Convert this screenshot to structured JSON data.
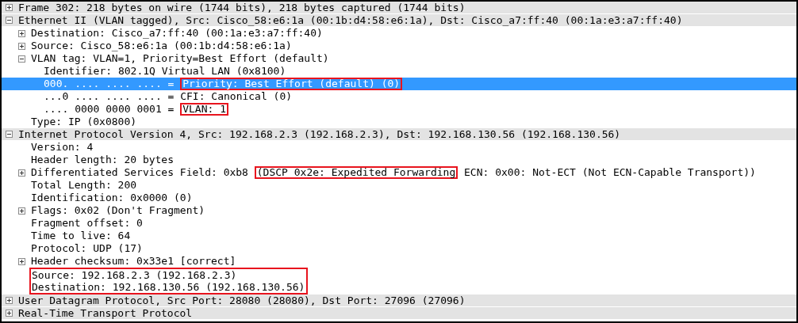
{
  "tree": [
    {
      "kind": "field",
      "expanded": false,
      "selected": false,
      "segments": [
        {
          "text": "Frame 302: 218 bytes on wire (1744 bits), 218 bytes captured (1744 bits)",
          "boxed": false
        }
      ]
    },
    {
      "kind": "field",
      "expanded": true,
      "selected": false,
      "segments": [
        {
          "text": "Ethernet II (VLAN tagged), Src: Cisco_58:e6:1a (00:1b:d4:58:e6:1a), Dst: Cisco_a7:ff:40 (00:1a:e3:a7:ff:40)",
          "boxed": false
        }
      ],
      "children": [
        {
          "kind": "field",
          "expanded": false,
          "selected": false,
          "segments": [
            {
              "text": "Destination: Cisco_a7:ff:40 (00:1a:e3:a7:ff:40)",
              "boxed": false
            }
          ]
        },
        {
          "kind": "field",
          "expanded": false,
          "selected": false,
          "segments": [
            {
              "text": "Source: Cisco_58:e6:1a (00:1b:d4:58:e6:1a)",
              "boxed": false
            }
          ]
        },
        {
          "kind": "field",
          "expanded": true,
          "selected": false,
          "segments": [
            {
              "text": "VLAN tag: VLAN=1, Priority=Best Effort (default)",
              "boxed": false
            }
          ],
          "children": [
            {
              "kind": "field",
              "selected": false,
              "segments": [
                {
                  "text": "Identifier: 802.1Q Virtual LAN (0x8100)",
                  "boxed": false
                }
              ]
            },
            {
              "kind": "field",
              "selected": true,
              "segments": [
                {
                  "text": "000. .... .... .... = ",
                  "boxed": false
                },
                {
                  "text": "Priority: Best Effort (default) (0)",
                  "boxed": true
                }
              ]
            },
            {
              "kind": "field",
              "selected": false,
              "segments": [
                {
                  "text": "...0 .... .... .... = CFI: Canonical (0)",
                  "boxed": false
                }
              ]
            },
            {
              "kind": "field",
              "selected": false,
              "segments": [
                {
                  "text": ".... 0000 0000 0001 = ",
                  "boxed": false
                },
                {
                  "text": "VLAN: 1",
                  "boxed": true
                }
              ]
            }
          ]
        },
        {
          "kind": "field",
          "selected": false,
          "segments": [
            {
              "text": "Type: IP (0x0800)",
              "boxed": false
            }
          ]
        }
      ]
    },
    {
      "kind": "field",
      "expanded": true,
      "selected": false,
      "segments": [
        {
          "text": "Internet Protocol Version 4, Src: 192.168.2.3 (192.168.2.3), Dst: 192.168.130.56 (192.168.130.56)",
          "boxed": false
        }
      ],
      "children": [
        {
          "kind": "field",
          "selected": false,
          "segments": [
            {
              "text": "Version: 4",
              "boxed": false
            }
          ]
        },
        {
          "kind": "field",
          "selected": false,
          "segments": [
            {
              "text": "Header length: 20 bytes",
              "boxed": false
            }
          ]
        },
        {
          "kind": "field",
          "expanded": false,
          "selected": false,
          "segments": [
            {
              "text": "Differentiated Services Field: 0xb8 ",
              "boxed": false
            },
            {
              "text": "(DSCP 0x2e: Expedited Forwarding",
              "boxed": true
            },
            {
              "text": " ECN: 0x00: Not-ECT (Not ECN-Capable Transport))",
              "boxed": false
            }
          ]
        },
        {
          "kind": "field",
          "selected": false,
          "segments": [
            {
              "text": "Total Length: 200",
              "boxed": false
            }
          ]
        },
        {
          "kind": "field",
          "selected": false,
          "segments": [
            {
              "text": "Identification: 0x0000 (0)",
              "boxed": false
            }
          ]
        },
        {
          "kind": "field",
          "expanded": false,
          "selected": false,
          "segments": [
            {
              "text": "Flags: 0x02 (Don't Fragment)",
              "boxed": false
            }
          ]
        },
        {
          "kind": "field",
          "selected": false,
          "segments": [
            {
              "text": "Fragment offset: 0",
              "boxed": false
            }
          ]
        },
        {
          "kind": "field",
          "selected": false,
          "segments": [
            {
              "text": "Time to live: 64",
              "boxed": false
            }
          ]
        },
        {
          "kind": "field",
          "selected": false,
          "segments": [
            {
              "text": "Protocol: UDP (17)",
              "boxed": false
            }
          ]
        },
        {
          "kind": "field",
          "expanded": false,
          "selected": false,
          "segments": [
            {
              "text": "Header checksum: 0x33e1 [correct]",
              "boxed": false
            }
          ]
        },
        {
          "kind": "boxed_group",
          "items": [
            {
              "kind": "field",
              "selected": false,
              "segments": [
                {
                  "text": "Source: 192.168.2.3 (192.168.2.3)",
                  "boxed": false
                }
              ]
            },
            {
              "kind": "field",
              "selected": false,
              "segments": [
                {
                  "text": "Destination: 192.168.130.56 (192.168.130.56)",
                  "boxed": false
                }
              ]
            }
          ]
        }
      ]
    },
    {
      "kind": "field",
      "expanded": false,
      "selected": false,
      "segments": [
        {
          "text": "User Datagram Protocol, Src Port: 28080 (28080), Dst Port: 27096 (27096)",
          "boxed": false
        }
      ]
    },
    {
      "kind": "field",
      "expanded": false,
      "selected": false,
      "segments": [
        {
          "text": "Real-Time Transport Protocol",
          "boxed": false
        }
      ]
    }
  ]
}
